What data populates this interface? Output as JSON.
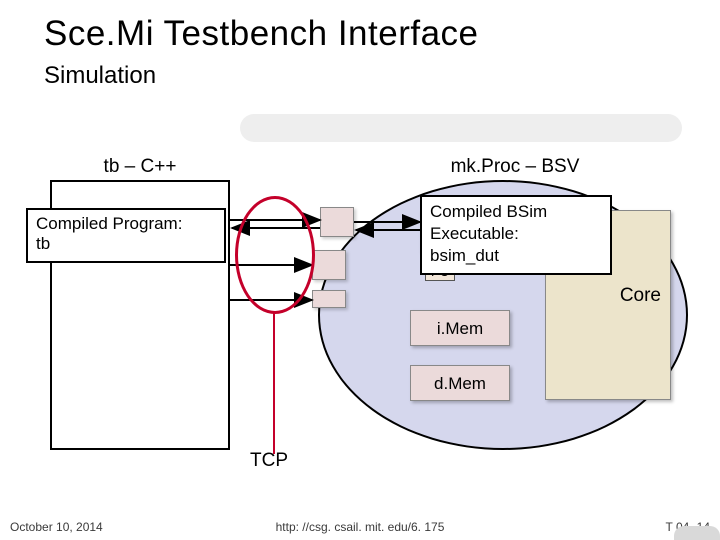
{
  "title": "Sce.Mi Testbench Interface",
  "subtitle": "Simulation",
  "tb_label": "tb – C++",
  "proc_label": "mk.Proc – BSV",
  "core_label": "Core",
  "pc_label": "PC",
  "imem_label": "i.Mem",
  "dmem_label": "d.Mem",
  "tcp_label": "TCP",
  "compiled_tb_line1": "Compiled Program:",
  "compiled_tb_line2": "tb",
  "compiled_bsim_line1": "Compiled BSim",
  "compiled_bsim_line2": "Executable:",
  "compiled_bsim_line3": "bsim_dut",
  "footer_date": "October 10, 2014",
  "footer_url": "http: //csg. csail. mit. edu/6. 175",
  "footer_slide": "T 04 -14"
}
